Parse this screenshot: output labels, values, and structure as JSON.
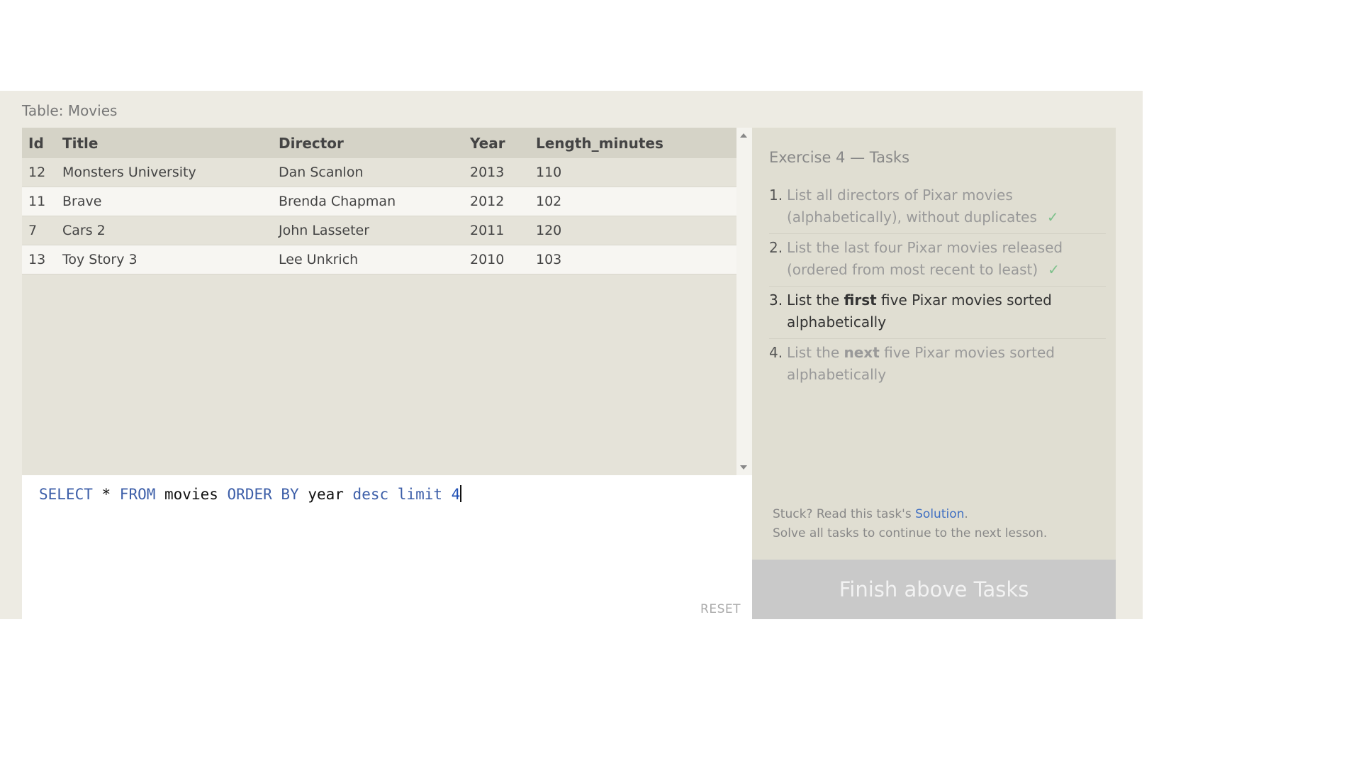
{
  "table_caption": "Table: Movies",
  "table": {
    "columns": [
      "Id",
      "Title",
      "Director",
      "Year",
      "Length_minutes"
    ],
    "rows": [
      [
        "12",
        "Monsters University",
        "Dan Scanlon",
        "2013",
        "110"
      ],
      [
        "11",
        "Brave",
        "Brenda Chapman",
        "2012",
        "102"
      ],
      [
        "7",
        "Cars 2",
        "John Lasseter",
        "2011",
        "120"
      ],
      [
        "13",
        "Toy Story 3",
        "Lee Unkrich",
        "2010",
        "103"
      ]
    ]
  },
  "editor": {
    "query_tokens": {
      "t1": "SELECT",
      "t2": " * ",
      "t3": "FROM",
      "t4": " movies ",
      "t5": "ORDER BY",
      "t6": " year ",
      "t7": "desc",
      "t8": " ",
      "t9": "limit",
      "t10": " ",
      "t11": "4"
    },
    "reset_label": "RESET"
  },
  "tasks": {
    "title": "Exercise 4 — Tasks",
    "items": [
      {
        "num": "1.",
        "text": "List all directors of Pixar movies (alphabetically), without duplicates",
        "done": true
      },
      {
        "num": "2.",
        "text": "List the last four Pixar movies released (ordered from most recent to least)",
        "done": true
      },
      {
        "num": "3.",
        "pre": "List the ",
        "bold": "first",
        "post": " five Pixar movies sorted alphabetically",
        "done": false
      },
      {
        "num": "4.",
        "pre": "List the ",
        "bold": "next",
        "post": " five Pixar movies sorted alphabetically",
        "done": false
      }
    ],
    "check_mark": "✓",
    "hint_prefix": "Stuck? Read this task's ",
    "hint_link": "Solution",
    "hint_suffix": ".",
    "hint_line2": "Solve all tasks to continue to the next lesson.",
    "finish_label": "Finish above Tasks"
  }
}
